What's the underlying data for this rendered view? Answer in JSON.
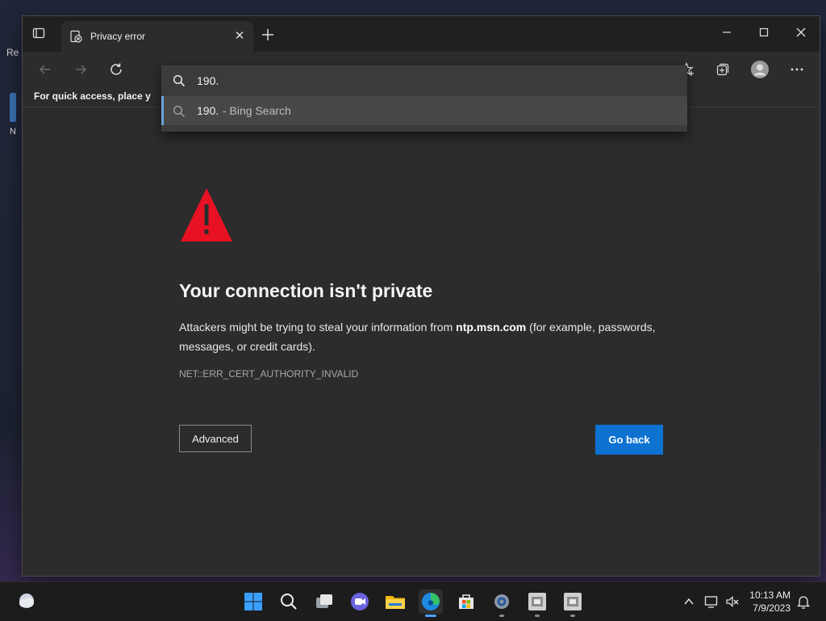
{
  "browser": {
    "tab": {
      "title": "Privacy error"
    },
    "favorites_bar_text": "For quick access, place y",
    "address": {
      "typed_text": "190.",
      "suggestion": {
        "query": "190.",
        "source": " - Bing Search"
      }
    }
  },
  "error_page": {
    "title": "Your connection isn't private",
    "body_before": "Attackers might be trying to steal your information from ",
    "body_host": "ntp.msn.com",
    "body_after": " (for example, passwords, messages, or credit cards).",
    "error_code": "NET::ERR_CERT_AUTHORITY_INVALID",
    "advanced_label": "Advanced",
    "go_back_label": "Go back",
    "accent_color": "#0e72d1",
    "warning_color": "#e81123"
  },
  "desktop": {
    "peek_text": "Re",
    "peek_text2": "N"
  },
  "taskbar": {
    "clock_time": "10:13 AM",
    "clock_date": "7/9/2023",
    "pinned_icons": [
      "windows-start-icon",
      "search-icon",
      "task-view-icon",
      "teams-chat-icon",
      "file-explorer-icon",
      "edge-icon",
      "store-icon",
      "settings-icon",
      "app-icon",
      "app-icon"
    ]
  }
}
